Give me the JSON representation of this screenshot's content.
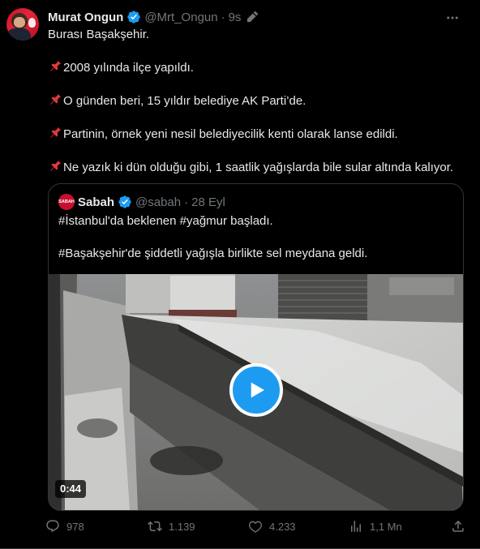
{
  "author": {
    "name": "Murat Ongun",
    "handle": "@Mrt_Ongun",
    "separator": "·",
    "time": "9s"
  },
  "tweet_lines": [
    "Burası Başakşehir.",
    "2008 yılında ilçe yapıldı.",
    "O günden beri, 15 yıldır belediye AK Parti’de.",
    "Partinin, örnek yeni nesil belediyecilik kenti olarak lanse edildi.",
    "Ne yazık ki dün olduğu gibi, 1 saatlik yağışlarda bile sular altında kalıyor."
  ],
  "quoted": {
    "avatar_text": "SABAH",
    "name": "Sabah",
    "handle": "@sabah",
    "separator": "·",
    "time": "28 Eyl",
    "line1": "#İstanbul'da beklenen #yağmur başladı.",
    "line2": "#Başakşehir'de şiddetli yağışla birlikte sel meydana geldi.",
    "video_duration": "0:44"
  },
  "actions": {
    "replies": "978",
    "reposts": "1.139",
    "likes": "4.233",
    "views": "1,1 Mn"
  },
  "colors": {
    "background": "#000000",
    "text": "#e7e9ea",
    "muted": "#71767b",
    "accent": "#1d9bf0",
    "border": "#2f3336"
  },
  "icons": [
    "verified-badge-icon",
    "edit-pencil-icon",
    "more-icon",
    "pushpin-icon",
    "play-icon",
    "reply-icon",
    "repost-icon",
    "like-icon",
    "views-icon",
    "share-icon"
  ]
}
